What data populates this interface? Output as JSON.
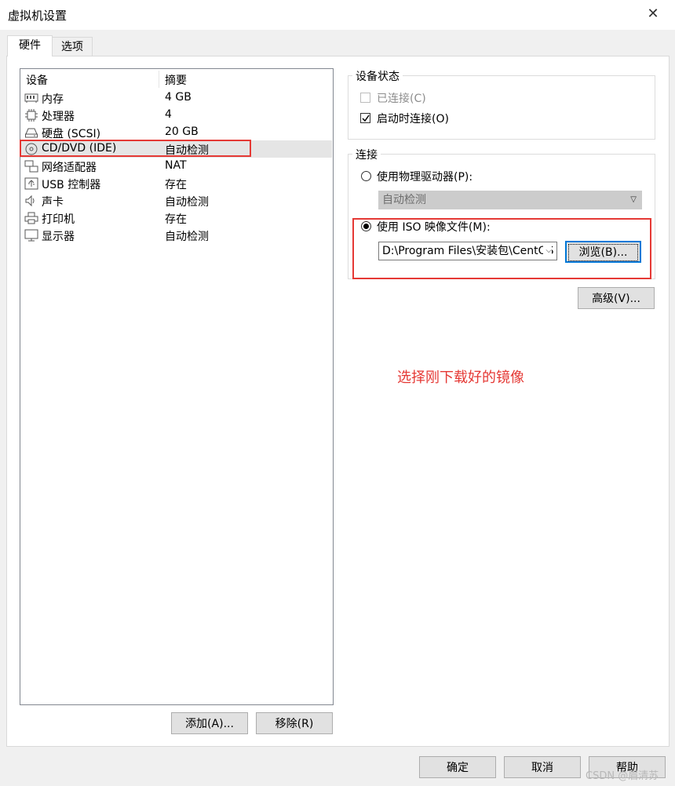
{
  "window": {
    "title": "虚拟机设置",
    "close_glyph": "✕"
  },
  "tabs": [
    {
      "label": "硬件",
      "active": true
    },
    {
      "label": "选项",
      "active": false
    }
  ],
  "device_list": {
    "columns": [
      "设备",
      "摘要"
    ],
    "rows": [
      {
        "name": "内存",
        "summary": "4 GB",
        "icon": "memory-icon"
      },
      {
        "name": "处理器",
        "summary": "4",
        "icon": "cpu-icon"
      },
      {
        "name": "硬盘 (SCSI)",
        "summary": "20 GB",
        "icon": "hard-disk-icon"
      },
      {
        "name": "CD/DVD (IDE)",
        "summary": "自动检测",
        "icon": "cd-dvd-icon",
        "selected": true
      },
      {
        "name": "网络适配器",
        "summary": "NAT",
        "icon": "network-adapter-icon"
      },
      {
        "name": "USB 控制器",
        "summary": "存在",
        "icon": "usb-icon"
      },
      {
        "name": "声卡",
        "summary": "自动检测",
        "icon": "speaker-icon"
      },
      {
        "name": "打印机",
        "summary": "存在",
        "icon": "printer-icon"
      },
      {
        "name": "显示器",
        "summary": "自动检测",
        "icon": "monitor-icon"
      }
    ]
  },
  "list_buttons": {
    "add": "添加(A)...",
    "remove": "移除(R)"
  },
  "device_status": {
    "title": "设备状态",
    "connected": {
      "label": "已连接(C)",
      "checked": false,
      "disabled": true
    },
    "connect_at_power_on": {
      "label": "启动时连接(O)",
      "checked": true
    }
  },
  "connection": {
    "title": "连接",
    "physical": {
      "label": "使用物理驱动器(P):",
      "selected": false,
      "value": "自动检测"
    },
    "iso": {
      "label": "使用 ISO 映像文件(M):",
      "selected": true,
      "value": "D:\\Program Files\\安装包\\CentOS",
      "browse": "浏览(B)..."
    }
  },
  "advanced_button": "高级(V)...",
  "annotation": "选择刚下载好的镜像",
  "footer": {
    "ok": "确定",
    "cancel": "取消",
    "help": "帮助"
  },
  "watermark": "CSDN @眉清苏",
  "colors": {
    "highlight_box": "#e53935",
    "selection": "#e5e5e5",
    "focus": "#0078d7"
  }
}
